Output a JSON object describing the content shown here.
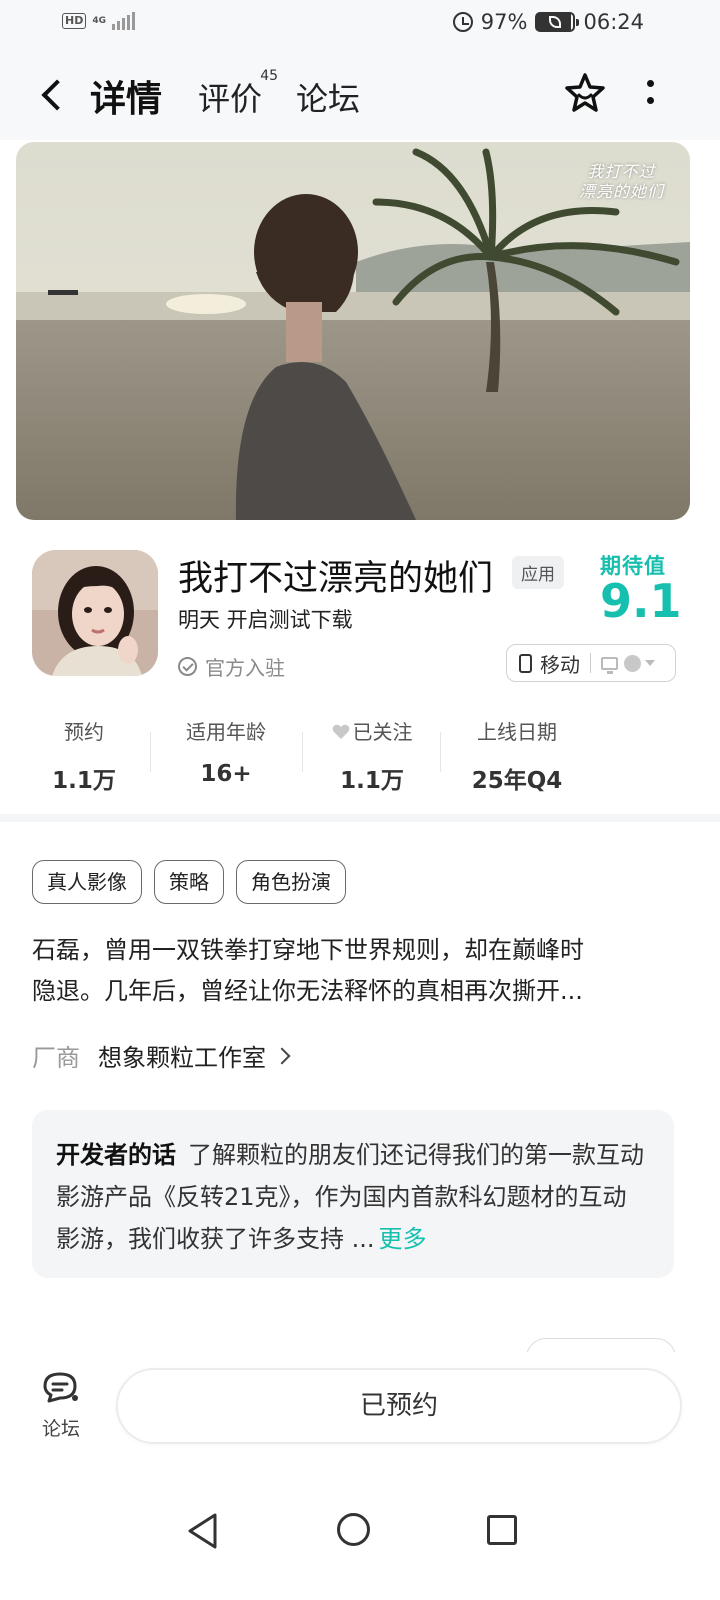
{
  "status_bar": {
    "hd": "HD",
    "network": "4G",
    "battery": "97%",
    "time": "06:24"
  },
  "header": {
    "tabs": [
      {
        "label": "详情",
        "active": true
      },
      {
        "label": "评价",
        "badge": "45"
      },
      {
        "label": "论坛"
      }
    ],
    "icons": [
      "back-arrow-icon",
      "star-outline-icon",
      "more-vertical-icon"
    ]
  },
  "banner": {
    "logo_text": "我打不过漂亮的她们"
  },
  "game": {
    "title": "我打不过漂亮的她们",
    "badge": "应用",
    "test_line": "明天 开启测试下载",
    "official": "官方入驻",
    "expect_label": "期待值",
    "expect_score": "9.1",
    "platform_label": "移动"
  },
  "stats": [
    {
      "label": "预约",
      "value": "1.1万"
    },
    {
      "label": "适用年龄",
      "value": "16+"
    },
    {
      "label": "已关注",
      "value": "1.1万"
    },
    {
      "label": "上线日期",
      "value": "25年Q4"
    }
  ],
  "tags": [
    "真人影像",
    "策略",
    "角色扮演"
  ],
  "description": {
    "line1": "石磊，曾用一双铁拳打穿地下世界规则，却在巅峰时",
    "line2": "隐退。几年后，曾经让你无法释怀的真相再次撕开..."
  },
  "vendor": {
    "label": "厂商",
    "name": "想象颗粒工作室"
  },
  "developer": {
    "heading": "开发者的话",
    "text": "了解颗粒的朋友们还记得我们的第一款互动影游产品《反转21克》，作为国内首款科幻题材的互动影游，我们收获了许多支持 ...",
    "more": "更多"
  },
  "bottom_bar": {
    "forum_label": "论坛",
    "reserve_label": "已预约"
  },
  "colors": {
    "accent": "#16bfae",
    "background": "#f7f8fa"
  }
}
